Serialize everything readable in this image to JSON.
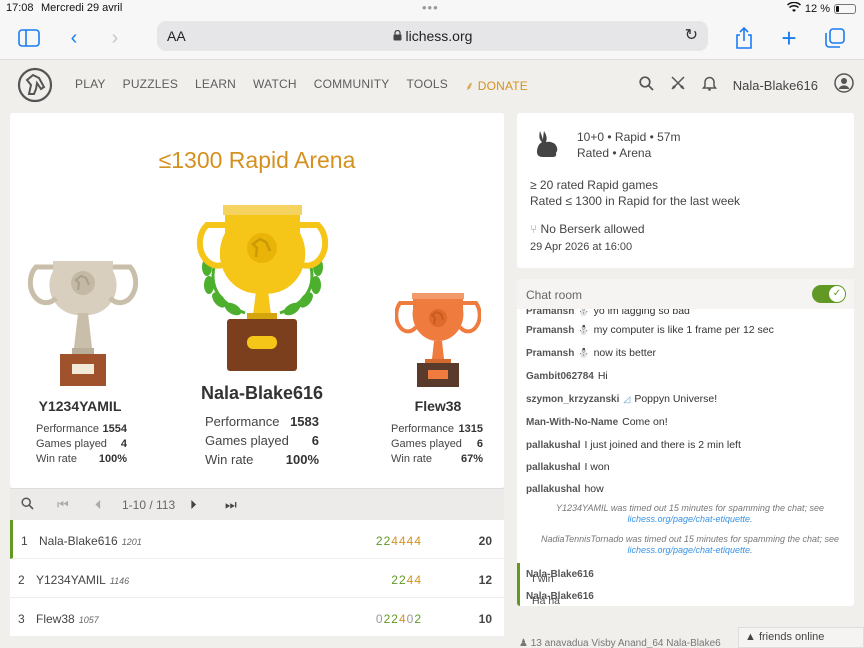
{
  "ios": {
    "time": "17:08",
    "date": "Mercredi 29 avril",
    "battery": "12 %"
  },
  "safari": {
    "aa": "AA",
    "url": "lichess.org"
  },
  "nav": {
    "items": [
      "PLAY",
      "PUZZLES",
      "LEARN",
      "WATCH",
      "COMMUNITY",
      "TOOLS"
    ],
    "donate": "DONATE",
    "username": "Nala-Blake616"
  },
  "podium": {
    "title": "≤1300 Rapid Arena",
    "first": {
      "name": "Nala-Blake616",
      "performance_label": "Performance",
      "performance": "1583",
      "games_label": "Games played",
      "games": "6",
      "winrate_label": "Win rate",
      "winrate": "100%"
    },
    "second": {
      "name": "Y1234YAMIL",
      "performance_label": "Performance",
      "performance": "1554",
      "games_label": "Games played",
      "games": "4",
      "winrate_label": "Win rate",
      "winrate": "100%"
    },
    "third": {
      "name": "Flew38",
      "performance_label": "Performance",
      "performance": "1315",
      "games_label": "Games played",
      "games": "6",
      "winrate_label": "Win rate",
      "winrate": "67%"
    }
  },
  "pager": {
    "range": "1-10 / 113"
  },
  "standings": [
    {
      "rank": "1",
      "name": "Nala-Blake616",
      "rating": "1201",
      "sheet": [
        {
          "d": "2",
          "c": "g"
        },
        {
          "d": "2",
          "c": "g"
        },
        {
          "d": "4",
          "c": "o"
        },
        {
          "d": "4",
          "c": "o"
        },
        {
          "d": "4",
          "c": "o"
        },
        {
          "d": "4",
          "c": "o"
        }
      ],
      "score": "20",
      "me": true
    },
    {
      "rank": "2",
      "name": "Y1234YAMIL",
      "rating": "1146",
      "sheet": [
        {
          "d": "2",
          "c": "g"
        },
        {
          "d": "2",
          "c": "g"
        },
        {
          "d": "4",
          "c": "o"
        },
        {
          "d": "4",
          "c": "o"
        }
      ],
      "score": "12",
      "me": false
    },
    {
      "rank": "3",
      "name": "Flew38",
      "rating": "1057",
      "sheet": [
        {
          "d": "0",
          "c": "gr"
        },
        {
          "d": "2",
          "c": "g"
        },
        {
          "d": "2",
          "c": "g"
        },
        {
          "d": "4",
          "c": "o"
        },
        {
          "d": "0",
          "c": "gr"
        },
        {
          "d": "2",
          "c": "g"
        }
      ],
      "score": "10",
      "me": false
    }
  ],
  "info": {
    "clock": "10+0 • Rapid • 57m",
    "rated": "Rated • Arena",
    "cond1": "≥ 20 rated Rapid games",
    "cond2": "Rated ≤ 1300 in Rapid for the last week",
    "berserk": "No Berserk allowed",
    "date": "29 Apr 2026 at 16:00"
  },
  "chat": {
    "title": "Chat room",
    "messages": [
      {
        "user": "Pramansh",
        "text": "yo im lagging so bad"
      },
      {
        "user": "Pramansh",
        "text": "my computer is like 1 frame per 12 sec"
      },
      {
        "user": "Pramansh",
        "text": "now its better"
      },
      {
        "user": "Gambit062784",
        "text": "Hi"
      },
      {
        "user": "szymon_krzyzanski",
        "text": "Poppyn Universe!"
      },
      {
        "user": "Man-With-No-Name",
        "text": "Come on!"
      },
      {
        "user": "pallakushal",
        "text": "I just joined and there is 2 min left"
      },
      {
        "user": "pallakushal",
        "text": "I won"
      },
      {
        "user": "pallakushal",
        "text": "how"
      }
    ],
    "system": [
      {
        "text": "Y1234YAMIL was timed out 15 minutes for spamming the chat; see",
        "link": "lichess.org/page/chat-etiquette"
      },
      {
        "text": "NadiaTennisTornado was timed out 15 minutes for spamming the chat; see",
        "link": "lichess.org/page/chat-etiquette"
      }
    ],
    "mine": [
      {
        "user": "Nala-Blake616",
        "text": "I win"
      },
      {
        "user": "Nala-Blake616",
        "text": "Ha ha"
      }
    ]
  },
  "friends": "friends online",
  "bottom_partial": "13  anavadua  Visby  Anand_64  Nala-Blake6"
}
